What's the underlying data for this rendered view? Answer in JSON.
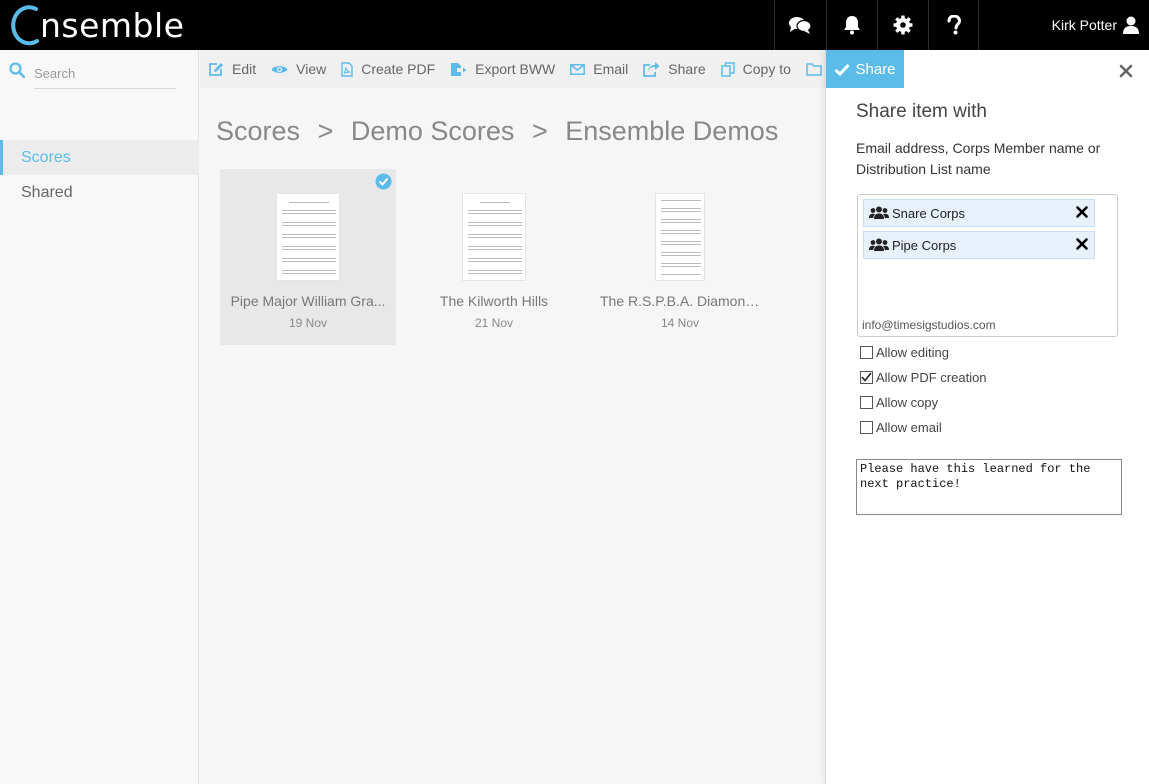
{
  "app": {
    "logo_text": "nsemble"
  },
  "header": {
    "icons": [
      "chat-icon",
      "bell-icon",
      "gear-icon",
      "question-icon"
    ],
    "user_name": "Kirk Potter"
  },
  "sidebar": {
    "search_placeholder": "Search",
    "items": [
      {
        "label": "Scores",
        "active": true
      },
      {
        "label": "Shared",
        "active": false
      }
    ]
  },
  "toolbar": {
    "items": [
      {
        "label": "Edit",
        "icon": "edit-icon"
      },
      {
        "label": "View",
        "icon": "eye-icon"
      },
      {
        "label": "Create PDF",
        "icon": "pdf-icon"
      },
      {
        "label": "Export BWW",
        "icon": "export-icon"
      },
      {
        "label": "Email",
        "icon": "envelope-icon"
      },
      {
        "label": "Share",
        "icon": "share-icon"
      },
      {
        "label": "Copy to",
        "icon": "copy-icon"
      }
    ]
  },
  "breadcrumb": {
    "parts": [
      "Scores",
      "Demo Scores",
      "Ensemble Demos"
    ],
    "separator": ">"
  },
  "scores": [
    {
      "title": "Pipe Major William Gra...",
      "date": "19 Nov",
      "selected": true
    },
    {
      "title": "The Kilworth Hills",
      "date": "21 Nov",
      "selected": false
    },
    {
      "title": "The R.S.P.B.A. Diamond...",
      "date": "14 Nov",
      "selected": false
    }
  ],
  "share_panel": {
    "share_button_label": "Share",
    "title": "Share item with",
    "description": "Email address, Corps Member name or Distribution List name",
    "recipients": [
      "Snare Corps",
      "Pipe Corps"
    ],
    "input_value": "info@timesigstudios.com",
    "options": [
      {
        "label": "Allow editing",
        "checked": false
      },
      {
        "label": "Allow PDF creation",
        "checked": true
      },
      {
        "label": "Allow copy",
        "checked": false
      },
      {
        "label": "Allow email",
        "checked": false
      }
    ],
    "message": "Please have this learned for the next practice!"
  },
  "colors": {
    "accent": "#5bbcea",
    "header_bg": "#000000",
    "chip_bg": "#e7f1fb"
  }
}
